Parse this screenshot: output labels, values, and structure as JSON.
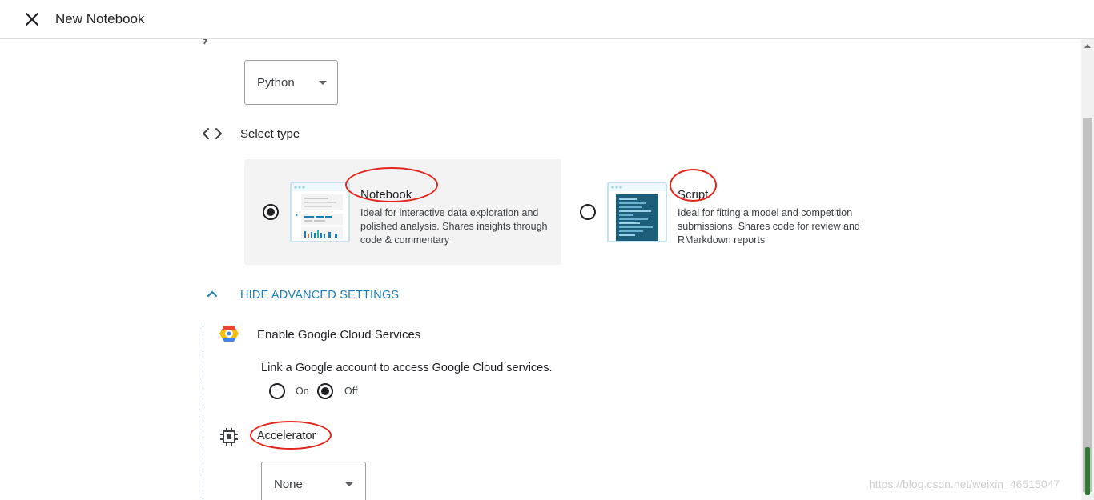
{
  "header": {
    "title": "New Notebook"
  },
  "language": {
    "selected": "Python"
  },
  "type_section": {
    "label": "Select type",
    "options": [
      {
        "title": "Notebook",
        "description": "Ideal for interactive data exploration and polished analysis. Shares insights through code & commentary",
        "selected": true
      },
      {
        "title": "Script",
        "description": "Ideal for fitting a model and competition submissions. Shares code for review and RMarkdown reports",
        "selected": false
      }
    ]
  },
  "advanced": {
    "toggle_label": "HIDE ADVANCED SETTINGS",
    "cloud": {
      "title": "Enable Google Cloud Services",
      "description": "Link a Google account to access Google Cloud services.",
      "on_label": "On",
      "off_label": "Off",
      "selected": "Off"
    },
    "accelerator": {
      "title": "Accelerator",
      "selected": "None"
    }
  },
  "watermark": "https://blog.csdn.net/weixin_46515047",
  "colors": {
    "accent": "#1a7fb5",
    "annotation": "#e3261b",
    "selected_card": "#f3f3f3"
  }
}
